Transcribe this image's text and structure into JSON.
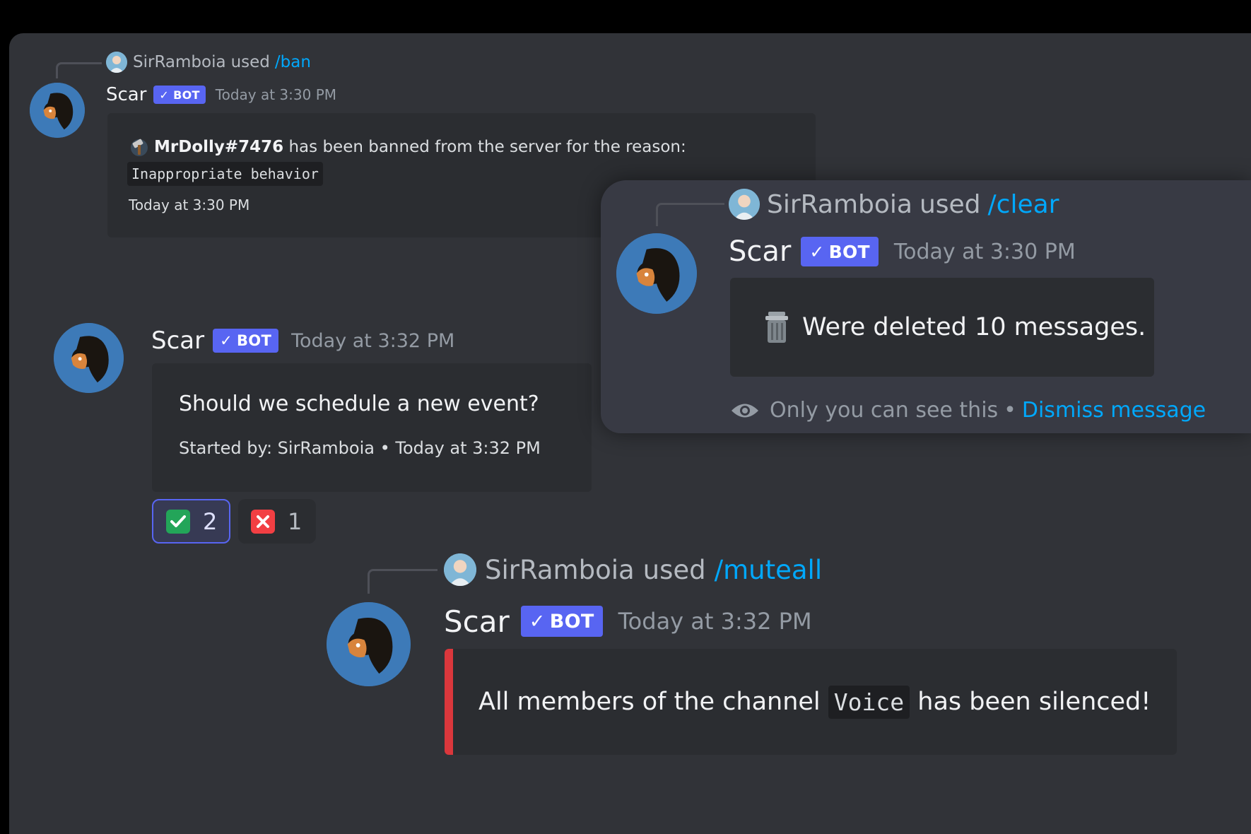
{
  "colors": {
    "background": "#313338",
    "embed": "#2b2d31",
    "bot_badge": "#5865f2",
    "command": "#00a8fc",
    "red_border": "#da373c",
    "check_green": "#23a559",
    "cross_red": "#f23f43"
  },
  "icons": [
    "scar-avatar",
    "sirramboia-avatar",
    "check-icon",
    "reaction-check",
    "reaction-cross",
    "trash-icon",
    "eye-icon",
    "ban-hammer-icon"
  ],
  "msg1": {
    "reply_user": "SirRamboia",
    "reply_used": "used",
    "reply_command": "/ban",
    "author": "Scar",
    "badge": "BOT",
    "timestamp": "Today at 3:30 PM",
    "banned_user": "MrDolly#7476",
    "ban_text": " has been banned from the server for the reason:",
    "reason": "Inappropriate behavior",
    "embed_footer": "Today at 3:30 PM"
  },
  "msg2": {
    "author": "Scar",
    "badge": "BOT",
    "timestamp": "Today at 3:32 PM",
    "question": "Should we schedule a new event?",
    "footer": "Started by: SirRamboia • Today at 3:32 PM",
    "reactions": [
      {
        "emoji": "check",
        "count": "2",
        "selected": true
      },
      {
        "emoji": "cross",
        "count": "1",
        "selected": false
      }
    ]
  },
  "msg3": {
    "reply_user": "SirRamboia",
    "reply_used": "used",
    "reply_command": "/clear",
    "author": "Scar",
    "badge": "BOT",
    "timestamp": "Today at 3:30 PM",
    "text": "Were deleted 10 messages.",
    "ephemeral_note": "Only you can see this",
    "separator": "•",
    "dismiss": "Dismiss message"
  },
  "msg4": {
    "reply_user": "SirRamboia",
    "reply_used": "used",
    "reply_command": "/muteall",
    "author": "Scar",
    "badge": "BOT",
    "timestamp": "Today at 3:32 PM",
    "text_before": "All members of the channel ",
    "channel": "Voice",
    "text_after": " has been silenced!"
  }
}
